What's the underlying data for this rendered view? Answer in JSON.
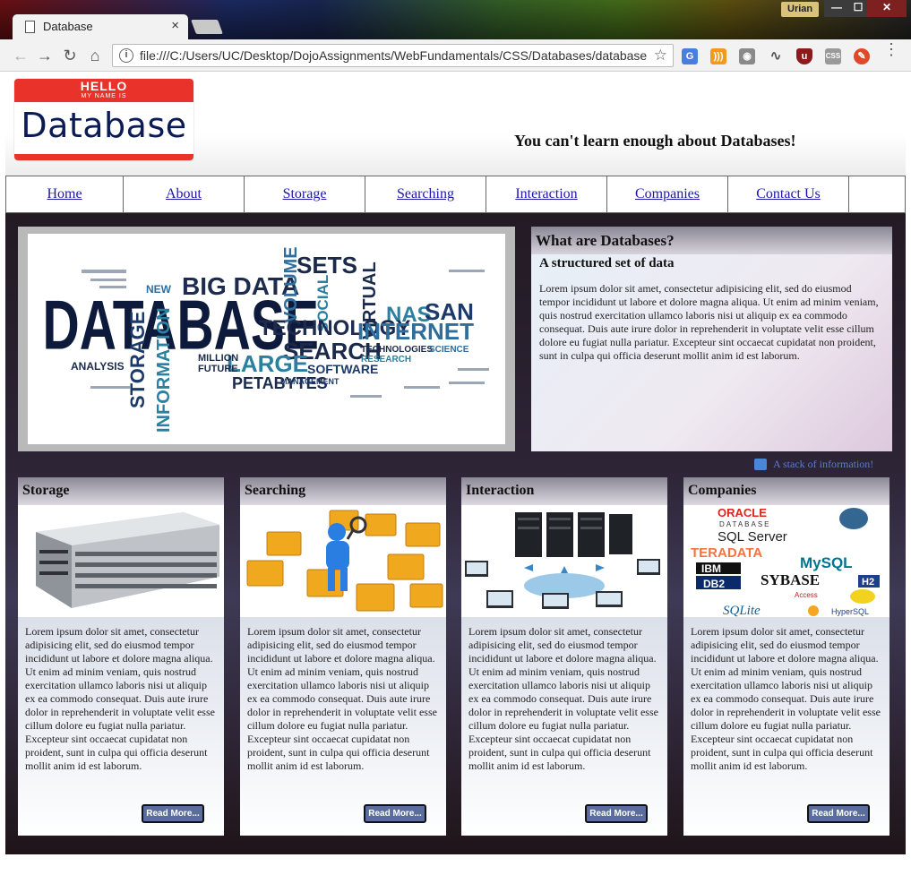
{
  "browser": {
    "tab_title": "Database",
    "tab_close": "×",
    "user_badge": "Urian",
    "url": "file:///C:/Users/UC/Desktop/DojoAssignments/WebFundamentals/CSS/Databases/databases",
    "window_min": "—",
    "window_max": "☐",
    "window_close": "✕",
    "nav_back": "←",
    "nav_forward": "→",
    "nav_reload": "↻",
    "nav_home": "⌂",
    "info_icon": "i",
    "bookmark_icon": "☆",
    "menu_icon": "⋮"
  },
  "header": {
    "logo_hello": "HELLO",
    "logo_myname": "MY NAME IS",
    "logo_name": "Database",
    "tagline": "You can't learn enough about Databases!"
  },
  "nav": {
    "items": [
      {
        "label": "Home"
      },
      {
        "label": "About"
      },
      {
        "label": "Storage"
      },
      {
        "label": "Searching"
      },
      {
        "label": "Interaction"
      },
      {
        "label": "Companies"
      },
      {
        "label": "Contact Us"
      }
    ]
  },
  "intro": {
    "heading": "What are Databases?",
    "subheading": "A structured set of data",
    "text": "Lorem ipsum dolor sit amet, consectetur adipisicing elit, sed do eiusmod tempor incididunt ut labore et dolore magna aliqua. Ut enim ad minim veniam, quis nostrud exercitation ullamco laboris nisi ut aliquip ex ea commodo consequat. Duis aute irure dolor in reprehenderit in voluptate velit esse cillum dolore eu fugiat nulla pariatur. Excepteur sint occaecat cupidatat non proident, sunt in culpa qui officia deserunt mollit anim id est laborum."
  },
  "hero": {
    "words": [
      "DATABASE",
      "BIG DATA",
      "SETS",
      "VOLUME",
      "SOCIAL",
      "VIRTUAL",
      "NAS",
      "SAN",
      "TECHNOLOGY",
      "INTERNET",
      "SEARCH",
      "LARGE",
      "PETABYTES",
      "SOFTWARE",
      "STORAGE",
      "INFORMATION",
      "ANALYSIS",
      "NEW",
      "MILLION",
      "FUTURE",
      "MANAGEMENT",
      "RESEARCH",
      "TECHNOLOGIES",
      "SCIENCE"
    ]
  },
  "stack_link": "A stack of information!",
  "cards": [
    {
      "title": "Storage",
      "text": "Lorem ipsum dolor sit amet, consectetur adipisicing elit, sed do eiusmod tempor incididunt ut labore et dolore magna aliqua. Ut enim ad minim veniam, quis nostrud exercitation ullamco laboris nisi ut aliquip ex ea commodo consequat. Duis aute irure dolor in reprehenderit in voluptate velit esse cillum dolore eu fugiat nulla pariatur. Excepteur sint occaecat cupidatat non proident, sunt in culpa qui officia deserunt mollit anim id est laborum.",
      "button": "Read More..."
    },
    {
      "title": "Searching",
      "text": "Lorem ipsum dolor sit amet, consectetur adipisicing elit, sed do eiusmod tempor incididunt ut labore et dolore magna aliqua. Ut enim ad minim veniam, quis nostrud exercitation ullamco laboris nisi ut aliquip ex ea commodo consequat. Duis aute irure dolor in reprehenderit in voluptate velit esse cillum dolore eu fugiat nulla pariatur. Excepteur sint occaecat cupidatat non proident, sunt in culpa qui officia deserunt mollit anim id est laborum.",
      "button": "Read More..."
    },
    {
      "title": "Interaction",
      "text": "Lorem ipsum dolor sit amet, consectetur adipisicing elit, sed do eiusmod tempor incididunt ut labore et dolore magna aliqua. Ut enim ad minim veniam, quis nostrud exercitation ullamco laboris nisi ut aliquip ex ea commodo consequat. Duis aute irure dolor in reprehenderit in voluptate velit esse cillum dolore eu fugiat nulla pariatur. Excepteur sint occaecat cupidatat non proident, sunt in culpa qui officia deserunt mollit anim id est laborum.",
      "button": "Read More..."
    },
    {
      "title": "Companies",
      "text": "Lorem ipsum dolor sit amet, consectetur adipisicing elit, sed do eiusmod tempor incididunt ut labore et dolore magna aliqua. Ut enim ad minim veniam, quis nostrud exercitation ullamco laboris nisi ut aliquip ex ea commodo consequat. Duis aute irure dolor in reprehenderit in voluptate velit esse cillum dolore eu fugiat nulla pariatur. Excepteur sint occaecat cupidatat non proident, sunt in culpa qui officia deserunt mollit anim id est laborum.",
      "button": "Read More..."
    }
  ],
  "company_logos": [
    "ORACLE",
    "DATABASE",
    "SQL Server",
    "TERADATA",
    "MySQL",
    "IBM",
    "DB2",
    "SYBASE",
    "H2",
    "SQLite",
    "HyperSQL",
    "Access"
  ],
  "colors": {
    "link": "#1a1aa6",
    "stack_link": "#5b7bd6",
    "read_more_bg": "#5a6d9c",
    "logo_red": "#e8322a",
    "logo_navy": "#0b1b56"
  }
}
